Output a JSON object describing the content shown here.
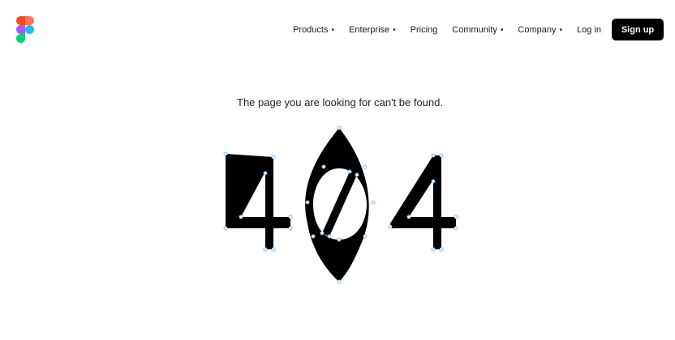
{
  "header": {
    "logo_icon": "figma-logo-icon",
    "logo_colors": [
      "#f24e1e",
      "#ff7262",
      "#a259ff",
      "#1abcfe",
      "#0acf83"
    ],
    "nav": [
      {
        "label": "Products",
        "dropdown": true
      },
      {
        "label": "Enterprise",
        "dropdown": true
      },
      {
        "label": "Pricing",
        "dropdown": false
      },
      {
        "label": "Community",
        "dropdown": true
      },
      {
        "label": "Company",
        "dropdown": true
      }
    ],
    "caret": "▾",
    "login_label": "Log in",
    "signup_label": "Sign up"
  },
  "main": {
    "message": "The page you are looking for can't be found.",
    "art_label": "404"
  },
  "colors": {
    "ink": "#000000",
    "handle_stroke": "#7fbde6",
    "background": "#ffffff"
  }
}
